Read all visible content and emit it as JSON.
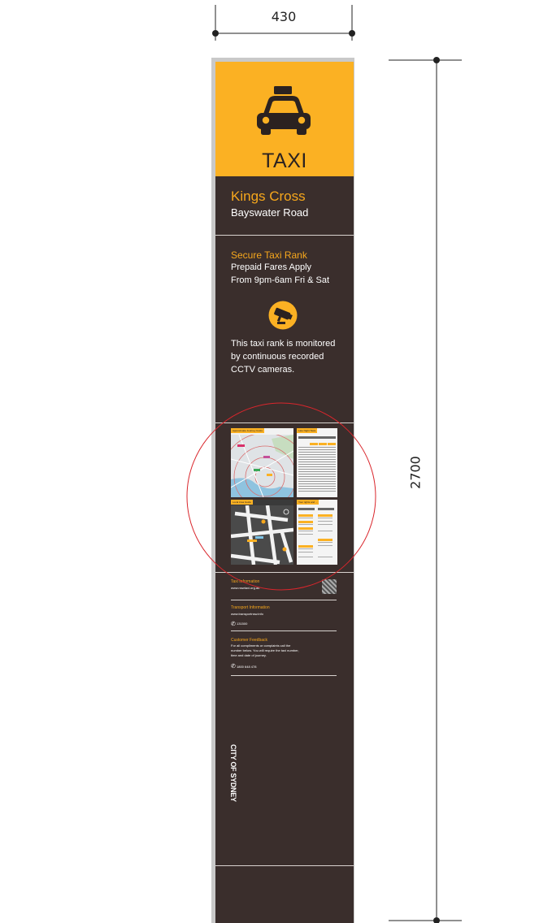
{
  "dimensions": {
    "width_label": "430",
    "height_label": "2700"
  },
  "sign": {
    "header": {
      "icon": "taxi-car-icon",
      "label": "TAXI"
    },
    "location": {
      "name": "Kings Cross",
      "street": "Bayswater Road"
    },
    "rank": {
      "title": "Secure Taxi Rank",
      "line1": "Prepaid Fares Apply",
      "line2": "From 9pm-6am Fri & Sat",
      "cctv_icon": "cctv-camera-icon",
      "cctv_line1": "This taxi rank is monitored",
      "cctv_line2": "by continuous recorded",
      "cctv_line3": "CCTV cameras."
    },
    "info_panels": {
      "journey_costs_title": "Approximate Journey Costs",
      "late_night_title": "Late Night Taxis",
      "local_area_title": "Local Area Guide",
      "rights_title": "Your rights and ..."
    },
    "taxi_info": {
      "title": "Taxi Information",
      "url": "www.nswtaxi.org.au"
    },
    "transport_info": {
      "title": "Transport Information",
      "url": "www.transportnsw.info",
      "phone": "131500"
    },
    "feedback": {
      "title": "Customer Feedback",
      "line1": "For all compliments or complaints call the",
      "line2": "number below. You will require the taxi number,",
      "line3": "time and date of journey.",
      "phone": "1800 648 478"
    },
    "logo": {
      "text": "CITY OF SYDNEY",
      "icon": "city-of-sydney-logo"
    }
  },
  "colors": {
    "accent": "#fbb123",
    "panel": "#3a2e2c",
    "callout_circle": "#d9262c"
  }
}
